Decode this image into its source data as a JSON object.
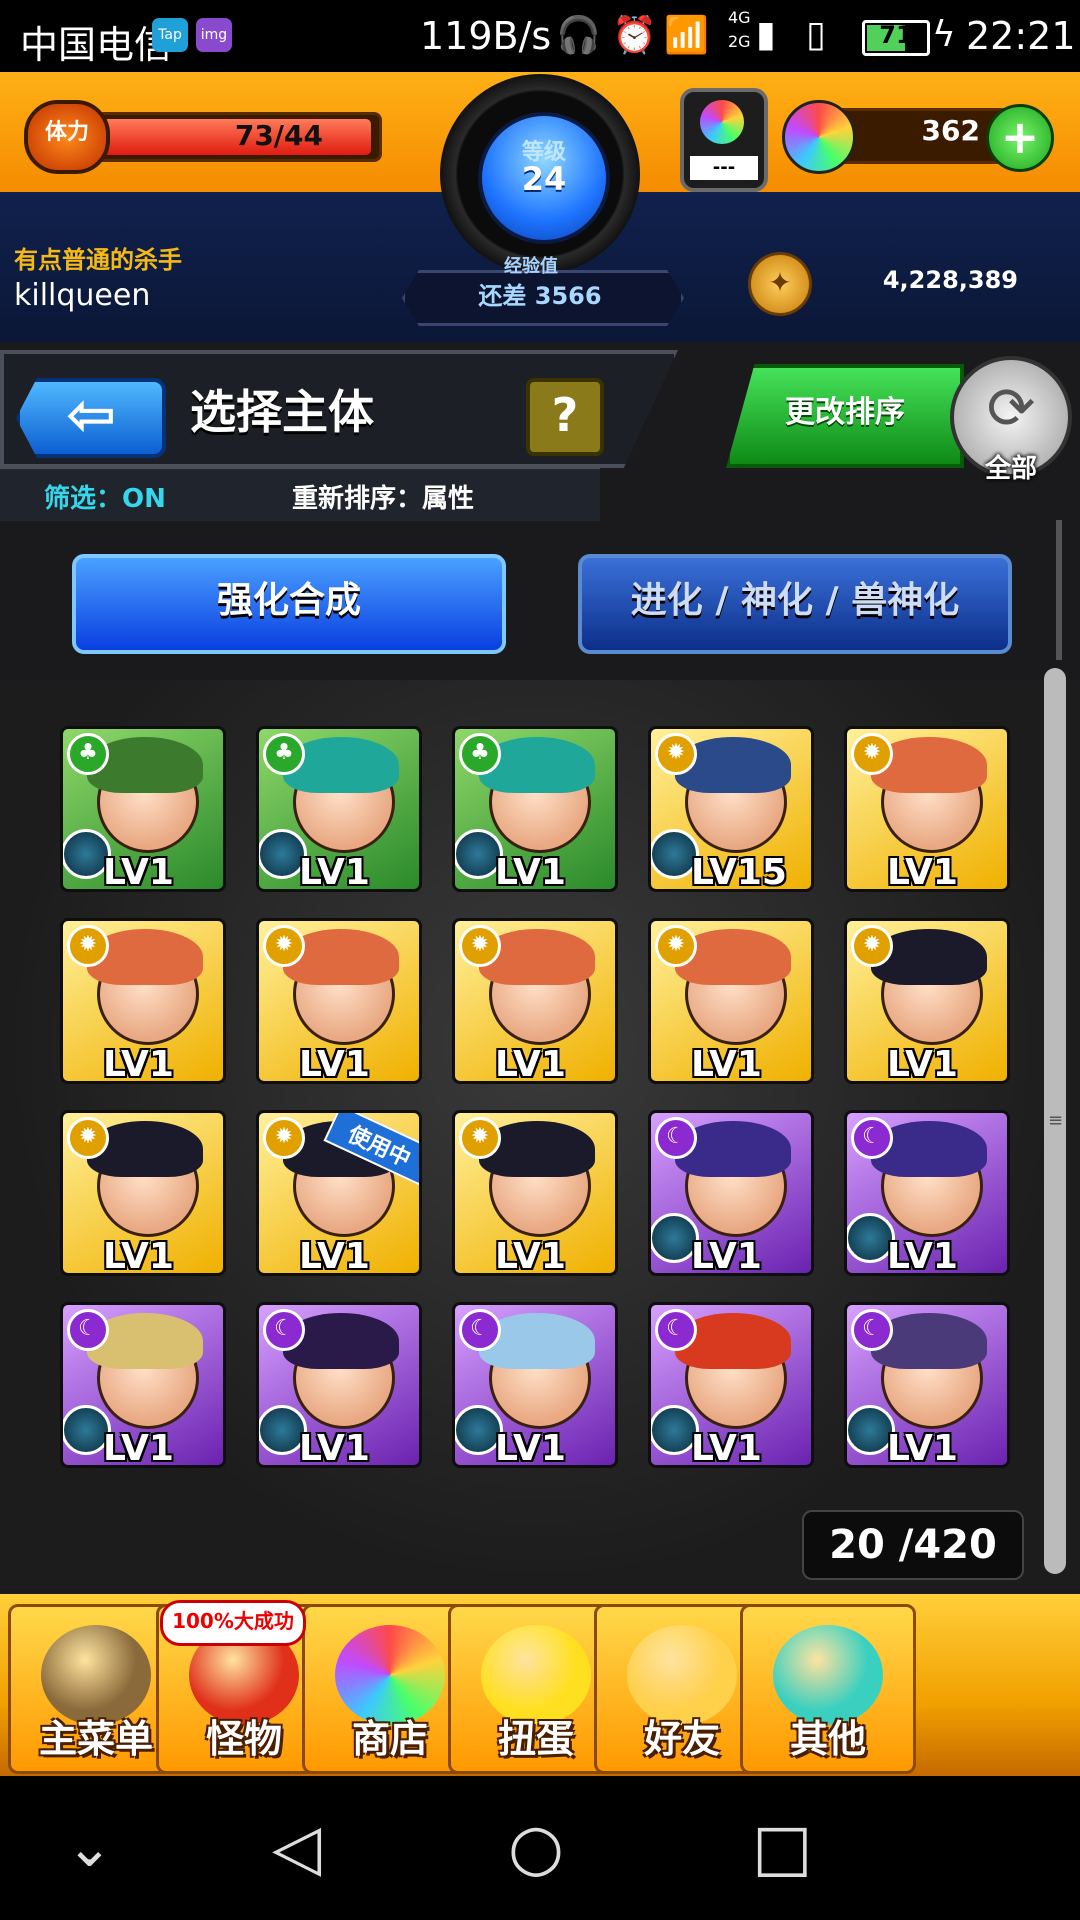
{
  "status_bar": {
    "carrier": "中国电信",
    "app_badges": [
      "Tap",
      "img"
    ],
    "net_speed": "119B/s",
    "signal_label_top": "4G",
    "signal_label_bottom": "2G",
    "battery": "71",
    "battery_fraction": 0.71,
    "time": "22:21",
    "icons": [
      "headphones-icon",
      "alarm-icon",
      "wifi-icon",
      "signal-icon",
      "sim-icon",
      "battery-icon",
      "charging-icon"
    ]
  },
  "header": {
    "stamina_label": "体力",
    "stamina_value": "73/44",
    "stamina_fraction": 1.0,
    "level_label": "等级",
    "level_value": "24",
    "exp_label": "经验值",
    "exp_value": "还差 3566",
    "player_title": "有点普通的杀手",
    "player_name": "killqueen",
    "orb_machine_value": "---",
    "gem_count": "362",
    "gem_plus": "+",
    "coin_count": "4,228,389"
  },
  "toolbar": {
    "back_symbol": "⇦",
    "page_title": "选择主体",
    "help_label": "?",
    "filter_text": "筛选：ON",
    "sort_text": "重新排序：属性",
    "change_sort_label": "更改排序",
    "all_label": "全部",
    "all_symbol": "⟳"
  },
  "modes": {
    "primary": "强化合成",
    "secondary": "进化 / 神化 / 兽神化"
  },
  "monsters": [
    {
      "element": "wood",
      "level": "LV1",
      "hair": "#3c7a2e",
      "in_use": false
    },
    {
      "element": "wood",
      "level": "LV1",
      "hair": "#1fa89a",
      "in_use": false
    },
    {
      "element": "wood",
      "level": "LV1",
      "hair": "#1fa89a",
      "in_use": false
    },
    {
      "element": "light",
      "level": "LV15",
      "hair": "#2a4a8a",
      "in_use": false
    },
    {
      "element": "light",
      "level": "LV1",
      "hair": "#e06a40",
      "in_use": false
    },
    {
      "element": "light",
      "level": "LV1",
      "hair": "#e06a40",
      "in_use": false
    },
    {
      "element": "light",
      "level": "LV1",
      "hair": "#e06a40",
      "in_use": false
    },
    {
      "element": "light",
      "level": "LV1",
      "hair": "#e06a40",
      "in_use": false
    },
    {
      "element": "light",
      "level": "LV1",
      "hair": "#e06a40",
      "in_use": false
    },
    {
      "element": "light",
      "level": "LV1",
      "hair": "#1a1a2a",
      "in_use": false
    },
    {
      "element": "light",
      "level": "LV1",
      "hair": "#1a1a2a",
      "in_use": false
    },
    {
      "element": "light",
      "level": "LV1",
      "hair": "#1a1a2a",
      "in_use": true
    },
    {
      "element": "light",
      "level": "LV1",
      "hair": "#1a1a2a",
      "in_use": false
    },
    {
      "element": "dark",
      "level": "LV1",
      "hair": "#3a2a8a",
      "in_use": false
    },
    {
      "element": "dark",
      "level": "LV1",
      "hair": "#3a2a8a",
      "in_use": false
    },
    {
      "element": "dark",
      "level": "LV1",
      "hair": "#d8c070",
      "in_use": false
    },
    {
      "element": "dark",
      "level": "LV1",
      "hair": "#2a1a4a",
      "in_use": false
    },
    {
      "element": "dark",
      "level": "LV1",
      "hair": "#9ac8e8",
      "in_use": false
    },
    {
      "element": "dark",
      "level": "LV1",
      "hair": "#d83a20",
      "in_use": false
    },
    {
      "element": "dark",
      "level": "LV1",
      "hair": "#4a3a7a",
      "in_use": false
    }
  ],
  "in_use_label": "使用中",
  "box": {
    "count": "20 /420"
  },
  "bottom_nav": {
    "promo": "100%大成功",
    "items": [
      {
        "label": "主菜单",
        "icon": "gate-icon",
        "color": "#8a6a3a"
      },
      {
        "label": "怪物",
        "icon": "monster-icon",
        "color": "#e0301a"
      },
      {
        "label": "商店",
        "icon": "orb-shop-icon",
        "color": "#b05aff"
      },
      {
        "label": "扭蛋",
        "icon": "egg-icon",
        "color": "#ffe020"
      },
      {
        "label": "好友",
        "icon": "friends-icon",
        "color": "#ffd04a"
      },
      {
        "label": "其他",
        "icon": "other-icon",
        "color": "#3ad0c0"
      }
    ]
  },
  "android_nav": {
    "down": "⌄",
    "back": "◁",
    "home": "○",
    "recent": "□"
  }
}
